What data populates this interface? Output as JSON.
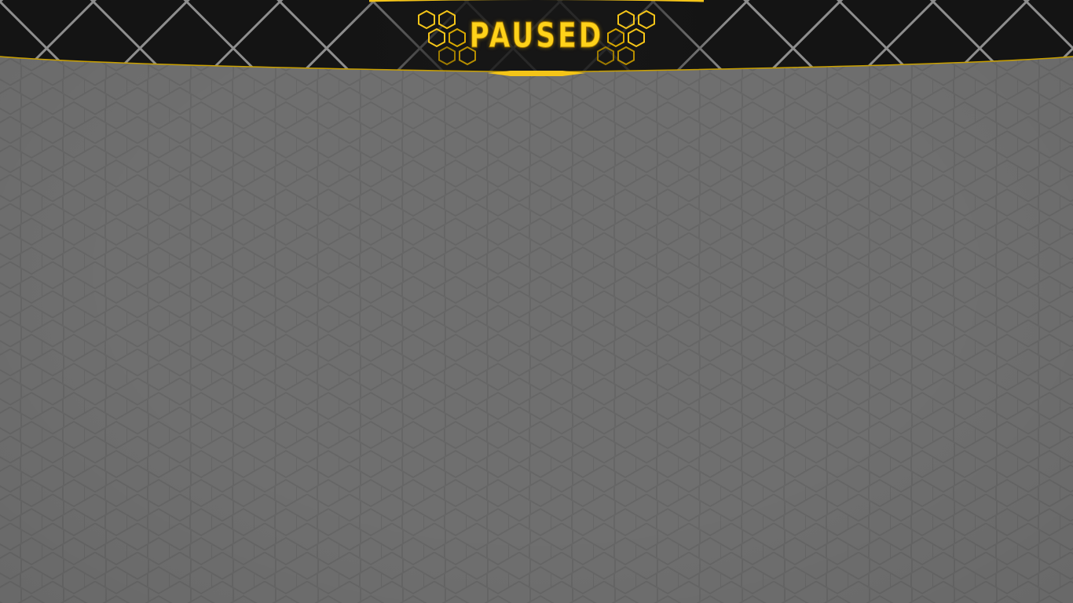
{
  "screen": "pause-menu",
  "banner": {
    "title": "PAUSED"
  },
  "colors": {
    "accent": "#f5c518",
    "banner_bg": "#161616",
    "overlay_bg": "#6f6f6f",
    "hex_pattern": "#636363",
    "lattice": "#9a9a9a"
  },
  "icons": {
    "left_ornament": "honeycomb-cluster-icon",
    "right_ornament": "honeycomb-cluster-icon"
  }
}
